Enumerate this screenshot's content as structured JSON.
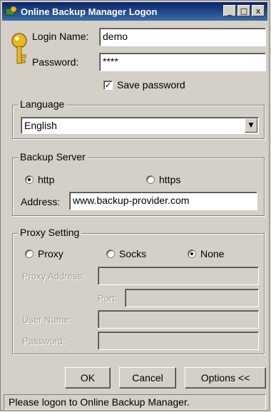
{
  "window": {
    "title": "Online Backup Manager Logon",
    "controls": {
      "minimize": "_",
      "maximize": "□",
      "close": "x"
    }
  },
  "login": {
    "name_label": "Login Name:",
    "name_value": "demo",
    "password_label": "Password:",
    "password_value": "****",
    "save_password_label": "Save password",
    "save_password_checked": true
  },
  "language": {
    "group_title": "Language",
    "selected": "English"
  },
  "backup_server": {
    "group_title": "Backup Server",
    "http_label": "http",
    "https_label": "https",
    "selected_protocol": "http",
    "address_label": "Address:",
    "address_value": "www.backup-provider.com"
  },
  "proxy": {
    "group_title": "Proxy Setting",
    "proxy_label": "Proxy",
    "socks_label": "Socks",
    "none_label": "None",
    "selected": "None",
    "address_label": "Proxy Address:",
    "port_label": "Port:",
    "username_label": "User Name:",
    "password_label": "Password:"
  },
  "buttons": {
    "ok": "OK",
    "cancel": "Cancel",
    "options": "Options <<"
  },
  "status": {
    "text": "Please logon to Online Backup Manager."
  },
  "colors": {
    "titlebar": "#0a246a",
    "face": "#d4d0c8",
    "key": "#e8b820"
  }
}
